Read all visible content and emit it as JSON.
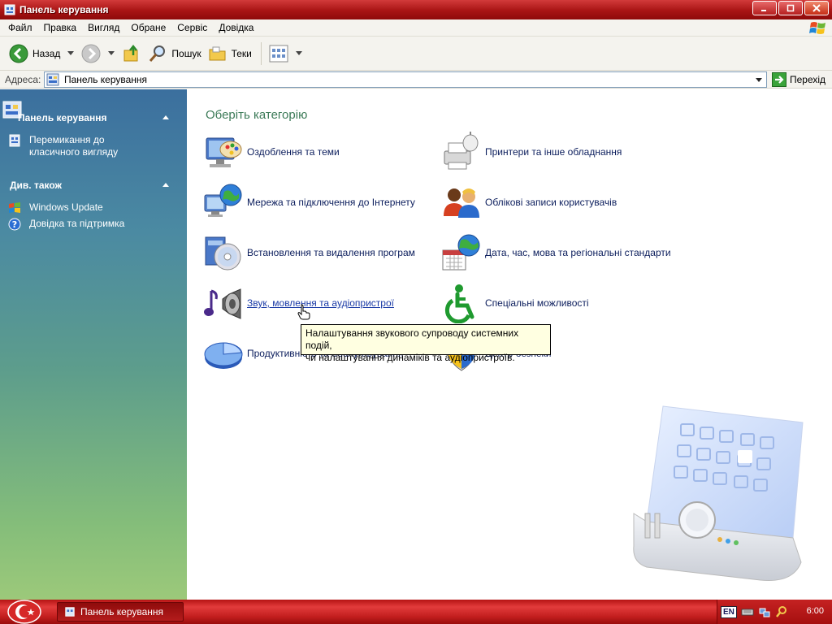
{
  "window": {
    "title": "Панель керування"
  },
  "menu": [
    "Файл",
    "Правка",
    "Вигляд",
    "Обране",
    "Сервіс",
    "Довідка"
  ],
  "toolbar": {
    "back_label": "Назад",
    "search_label": "Пошук",
    "folders_label": "Теки"
  },
  "address": {
    "label": "Адреса:",
    "value": "Панель керування",
    "go_label": "Перехід"
  },
  "sidebar": {
    "panel_title": "Панель керування",
    "switch_link": [
      "Перемикання до",
      "класичного вигляду"
    ],
    "see_also_title": "Див. також",
    "see_also": [
      "Windows Update",
      "Довідка та підтримка"
    ]
  },
  "main": {
    "heading": "Оберіть категорію",
    "categories": [
      {
        "label": "Оздоблення та теми",
        "icon": "appearance-themes-icon"
      },
      {
        "label": "Принтери та інше обладнання",
        "icon": "printers-hardware-icon"
      },
      {
        "label": "Мережа та підключення до Інтернету",
        "icon": "network-internet-icon"
      },
      {
        "label": "Облікові записи користувачів",
        "icon": "user-accounts-icon"
      },
      {
        "label": "Встановлення та видалення програм",
        "icon": "add-remove-programs-icon"
      },
      {
        "label": "Дата, час, мова та регіональні стандарти",
        "icon": "date-time-language-icon"
      },
      {
        "label": "Звук, мовлення та аудіопристрої",
        "icon": "sound-speech-audio-icon"
      },
      {
        "label": "Спеціальні можливості",
        "icon": "accessibility-icon"
      },
      {
        "label": "Продуктивність та обслуговування",
        "icon": "performance-maintenance-icon"
      },
      {
        "label": "Центр безпеки",
        "icon": "security-center-icon"
      }
    ],
    "tooltip": [
      "Налаштування звукового супроводу системних подій,",
      "чи налаштування динаміків та аудіопристроїв."
    ]
  },
  "taskbar": {
    "task_label": "Панель керування",
    "language": "EN",
    "clock": "6:00"
  }
}
